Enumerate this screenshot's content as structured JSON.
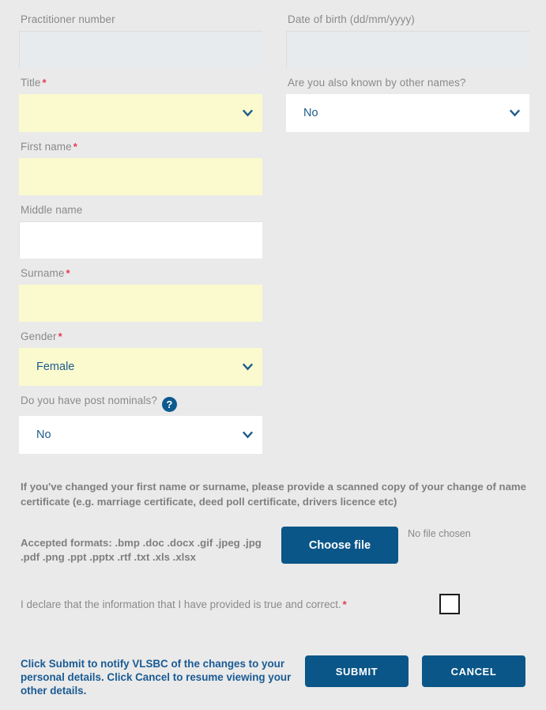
{
  "form": {
    "fields": {
      "practitioner_number": {
        "label": "Practitioner number",
        "value": "",
        "state": "readonly"
      },
      "date_of_birth": {
        "label": "Date of birth (dd/mm/yyyy)",
        "value": "",
        "state": "readonly"
      },
      "title": {
        "label": "Title",
        "required": "*",
        "value": "",
        "state": "required-empty"
      },
      "other_names": {
        "label": "Are you also known by other names?",
        "value": "No",
        "state": "optional"
      },
      "first_name": {
        "label": "First name",
        "required": "*",
        "value": "",
        "state": "required-empty"
      },
      "middle_name": {
        "label": "Middle name",
        "value": "",
        "state": "optional"
      },
      "surname": {
        "label": "Surname",
        "required": "*",
        "value": "",
        "state": "required-empty"
      },
      "gender": {
        "label": "Gender",
        "required": "*",
        "value": "Female",
        "state": "required-filled"
      },
      "post_nominals": {
        "label": "Do you have post nominals?",
        "value": "No",
        "state": "optional",
        "help_icon": "?"
      }
    }
  },
  "upload": {
    "notice": "If you've changed your first name or surname, please provide a scanned copy of your change of name certificate (e.g. marriage certificate, deed poll certificate, drivers licence etc)",
    "accepted_formats": "Accepted formats: .bmp .doc .docx .gif .jpeg .jpg .pdf .png .ppt .pptx .rtf .txt .xls .xlsx",
    "choose_file_label": "Choose file",
    "file_status": "No file chosen"
  },
  "declaration": {
    "text": "I declare that the information that I have provided is true and correct.",
    "required": "*",
    "checked": false
  },
  "footer": {
    "note": "Click Submit to notify VLSBC of the changes to your personal details. Click Cancel to resume viewing your other details.",
    "submit_label": "SUBMIT",
    "cancel_label": "CANCEL"
  },
  "colors": {
    "page_background": "#eaeaea",
    "accent_blue": "#0a5688",
    "required_yellow": "#fbfacf",
    "readonly_grey": "#e7ebed",
    "label_grey": "#8a8a8a",
    "asterisk_red": "#e8384f"
  }
}
